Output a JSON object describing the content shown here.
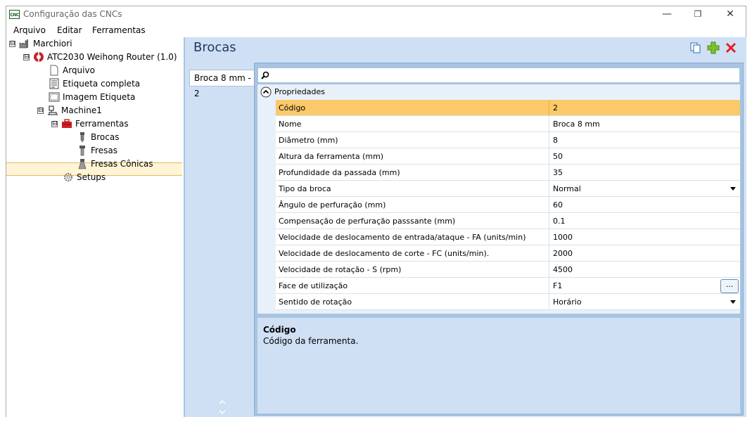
{
  "window": {
    "title": "Configuração das CNCs",
    "app_icon_text": "CNC"
  },
  "window_controls": {
    "minimize": "—",
    "maximize": "❐",
    "close": "✕"
  },
  "menu": [
    "Arquivo",
    "Editar",
    "Ferramentas"
  ],
  "tree": [
    {
      "label": "Marchiori",
      "expander": "⊟"
    },
    {
      "label": "ATC2030 Weihong Router (1.0)",
      "expander": "⊟"
    },
    {
      "label": "Arquivo"
    },
    {
      "label": "Etiqueta completa"
    },
    {
      "label": "Imagem Etiqueta"
    },
    {
      "label": "Machine1",
      "expander": "⊟"
    },
    {
      "label": "Ferramentas",
      "expander": "⊟"
    },
    {
      "label": "Brocas"
    },
    {
      "label": "Fresas"
    },
    {
      "label": "Fresas Cônicas"
    },
    {
      "label": "Setups"
    }
  ],
  "header": {
    "title": "Brocas"
  },
  "tabs": [
    {
      "label": "Broca 8 mm - 2"
    }
  ],
  "grid": {
    "category": "Propriedades",
    "rows": [
      {
        "name": "Código",
        "value": "2"
      },
      {
        "name": "Nome",
        "value": "Broca 8 mm"
      },
      {
        "name": "Diâmetro (mm)",
        "value": "8"
      },
      {
        "name": "Altura da ferramenta (mm)",
        "value": "50"
      },
      {
        "name": "Profundidade da passada (mm)",
        "value": "35"
      },
      {
        "name": "Tipo da broca",
        "value": "Normal"
      },
      {
        "name": "Ângulo de perfuração (mm)",
        "value": "60"
      },
      {
        "name": "Compensação de perfuração passsante (mm)",
        "value": "0.1"
      },
      {
        "name": "Velocidade de deslocamento de entrada/ataque - FA (units/min)",
        "value": "1000"
      },
      {
        "name": "Velocidade de deslocamento de corte - FC (units/min).",
        "value": "2000"
      },
      {
        "name": "Velocidade de rotação - S (rpm)",
        "value": "4500"
      },
      {
        "name": "Face de utilização",
        "value": "F1"
      },
      {
        "name": "Sentido de rotação",
        "value": "Horário"
      }
    ],
    "ellipsis_label": "..."
  },
  "help": {
    "title": "Código",
    "description": "Código da ferramenta."
  },
  "colors": {
    "selected_row": "#fbc86a",
    "panel_bg": "#cfe0f5",
    "accent": "#1e3a5f"
  }
}
